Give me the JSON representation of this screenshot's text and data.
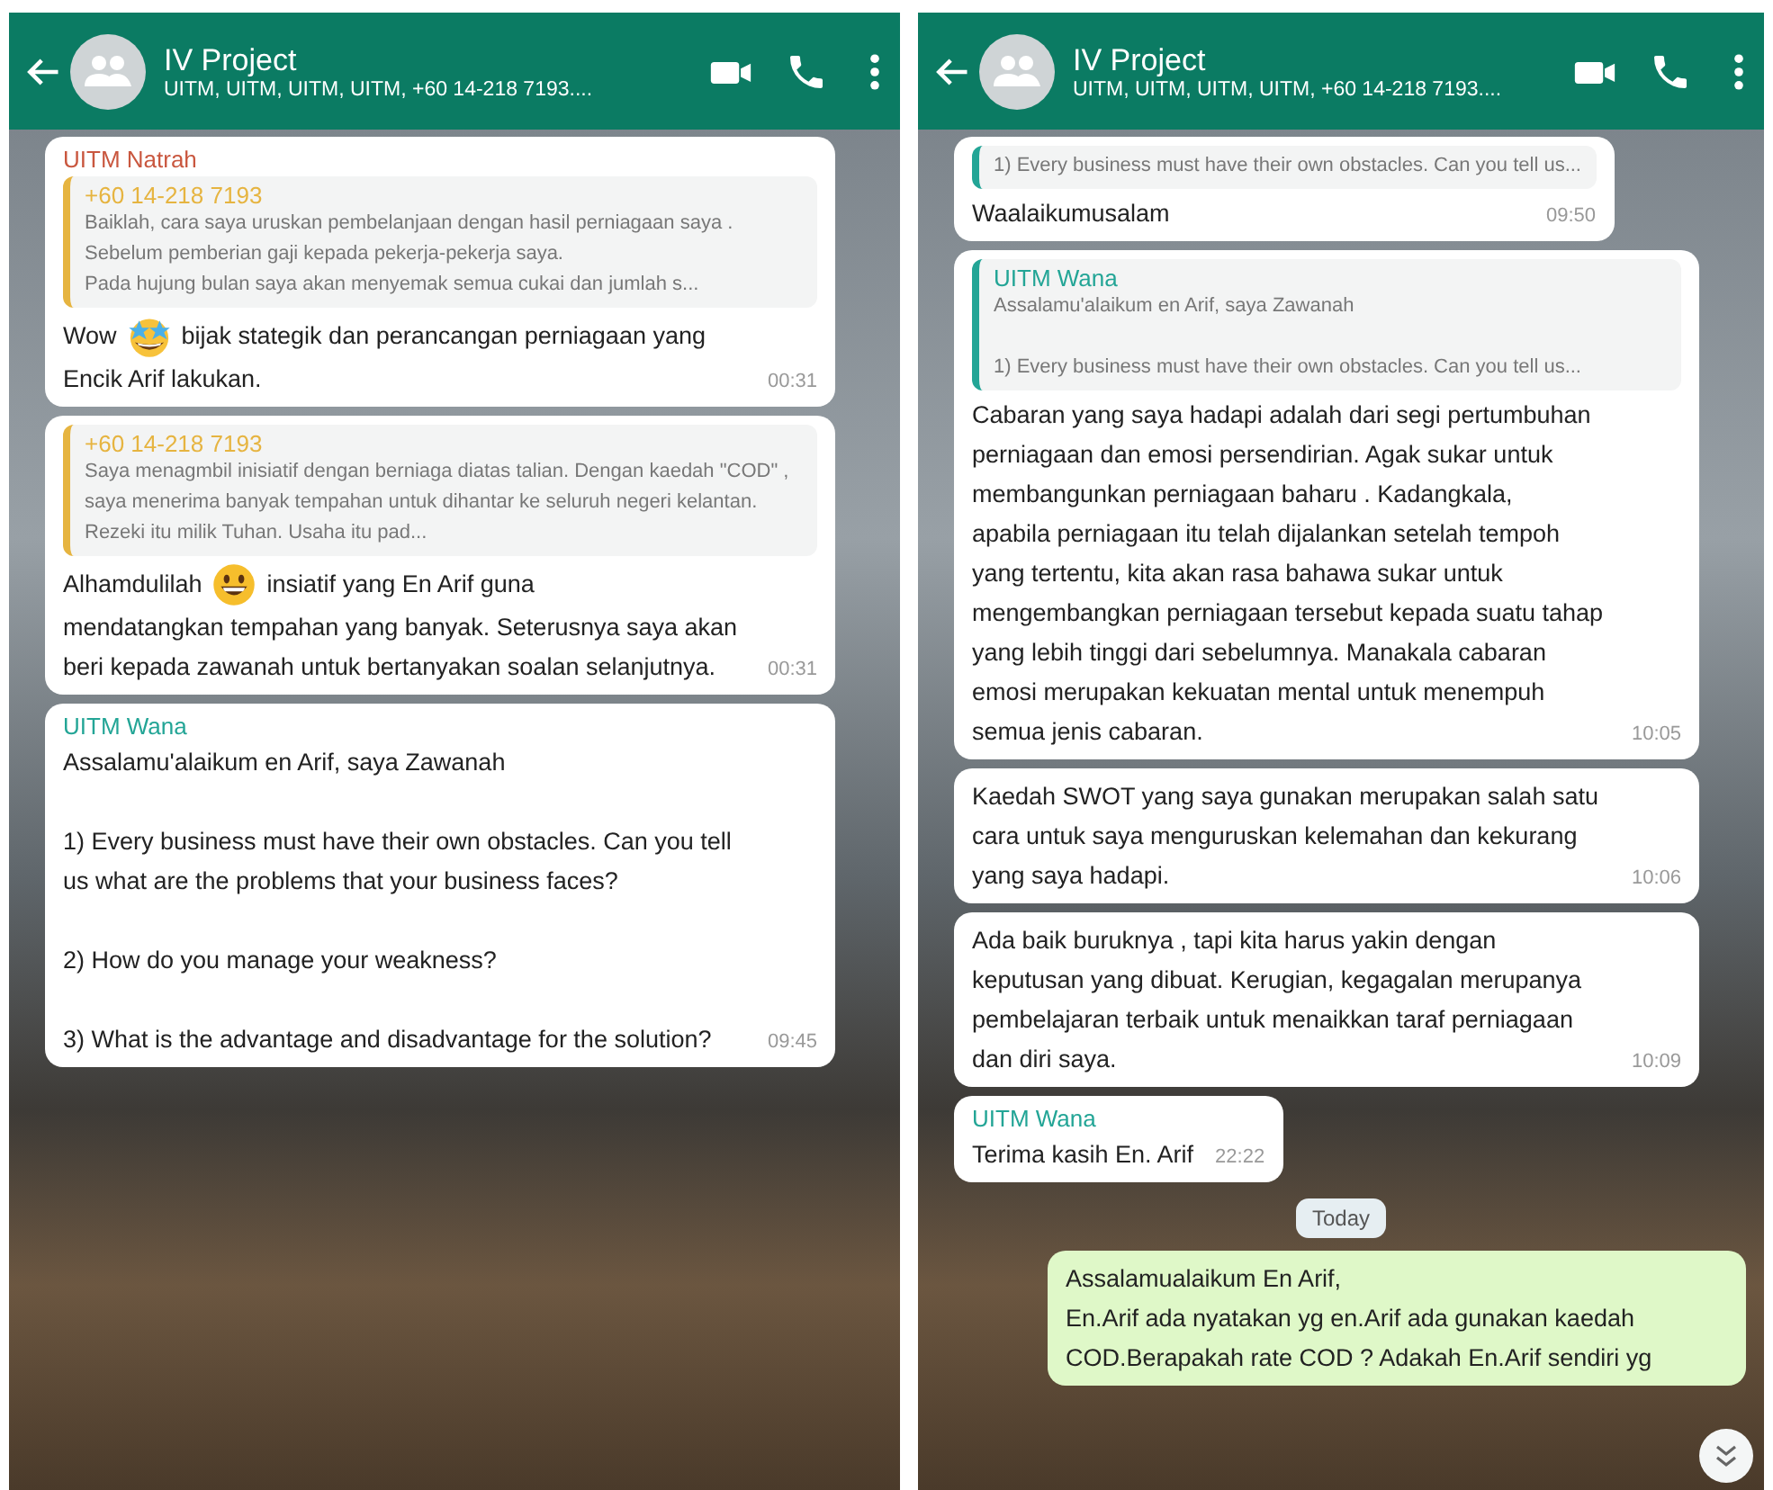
{
  "screens": [
    {
      "header": {
        "title": "IV Project",
        "subtitle": "UITM, UITM, UITM, UITM, +60 14-218 7193...."
      },
      "messages": [
        {
          "kind": "incoming",
          "sender": "UITM Natrah",
          "color": "#c9573f",
          "quote": {
            "author": "+60 14-218 7193",
            "color": "#e6b440",
            "text": "Baiklah, cara saya uruskan pembelanjaan dengan hasil perniagaan saya . Sebelum pemberian gaji kepada pekerja-pekerja saya.\nPada hujung bulan saya akan menyemak semua cukai dan jumlah s..."
          },
          "first_line": [
            {
              "kind": "text",
              "text": "Wow"
            },
            {
              "kind": "stareyes"
            },
            {
              "kind": "text",
              "text": "bijak stategik dan perancangan perniagaan yang"
            }
          ],
          "text": "Encik Arif lakukan.",
          "time": "00:31"
        },
        {
          "kind": "incoming",
          "quote": {
            "author": "+60 14-218 7193",
            "color": "#e6b440",
            "text": "Saya menagmbil inisiatif dengan berniaga diatas talian. Dengan kaedah \"COD\" , saya menerima banyak tempahan untuk dihantar ke seluruh negeri kelantan. Rezeki itu milik Tuhan. Usaha itu pad..."
          },
          "first_line": [
            {
              "kind": "text",
              "text": "Alhamdulilah"
            },
            {
              "kind": "grin"
            },
            {
              "kind": "text",
              "text": "insiatif yang En Arif guna"
            }
          ],
          "text": "mendatangkan tempahan yang banyak. Seterusnya saya akan beri kepada zawanah untuk bertanyakan soalan selanjutnya.",
          "time": "00:31"
        },
        {
          "kind": "incoming",
          "sender": "UITM Wana",
          "color": "#23a596",
          "text": "Assalamu'alaikum en Arif, saya Zawanah\n\n1) Every business must have their own obstacles. Can you tell us what are the problems that your business faces?\n\n2) How do you manage your weakness?\n\n3) What is the advantage and disadvantage for the solution?",
          "time": "09:45"
        }
      ]
    },
    {
      "header": {
        "title": "IV Project",
        "subtitle": "UITM, UITM, UITM, UITM, +60 14-218 7193...."
      },
      "messages": [
        {
          "kind": "incoming",
          "quote": {
            "color": "#23a596",
            "text": "1) Every business must have their own obstacles. Can you tell us..."
          },
          "text": "Waalaikumusalam",
          "time": "09:50"
        },
        {
          "kind": "incoming",
          "quote": {
            "author": "UITM Wana",
            "color": "#23a596",
            "text": "Assalamu'alaikum en Arif, saya Zawanah\n\n1) Every business must have their own obstacles. Can you tell us..."
          },
          "text": "Cabaran yang saya hadapi adalah dari segi pertumbuhan perniagaan dan emosi persendirian. Agak sukar untuk membangunkan perniagaan baharu . Kadangkala,\napabila perniagaan itu telah dijalankan setelah tempoh yang tertentu, kita akan rasa bahawa sukar untuk mengembangkan perniagaan tersebut kepada suatu tahap yang lebih tinggi dari sebelumnya. Manakala cabaran emosi merupakan kekuatan mental untuk menempuh semua jenis cabaran.",
          "time": "10:05"
        },
        {
          "kind": "incoming",
          "text": "Kaedah SWOT yang saya gunakan merupakan salah satu cara untuk saya menguruskan kelemahan dan kekurang yang saya hadapi.",
          "time": "10:06"
        },
        {
          "kind": "incoming",
          "text": "Ada baik buruknya , tapi kita harus yakin dengan keputusan yang dibuat. Kerugian, kegagalan merupanya pembelajaran terbaik untuk menaikkan taraf perniagaan dan diri saya.",
          "time": "10:09"
        },
        {
          "kind": "incoming",
          "sender": "UITM Wana",
          "color": "#23a596",
          "text": "Terima kasih En. Arif",
          "time": "22:22"
        },
        {
          "kind": "date",
          "text": "Today"
        },
        {
          "kind": "outgoing",
          "text": "Assalamualaikum En Arif,\nEn.Arif ada nyatakan yg en.Arif ada gunakan kaedah COD.Berapakah rate COD ? Adakah En.Arif sendiri yg"
        }
      ],
      "scroll_button": true
    }
  ]
}
